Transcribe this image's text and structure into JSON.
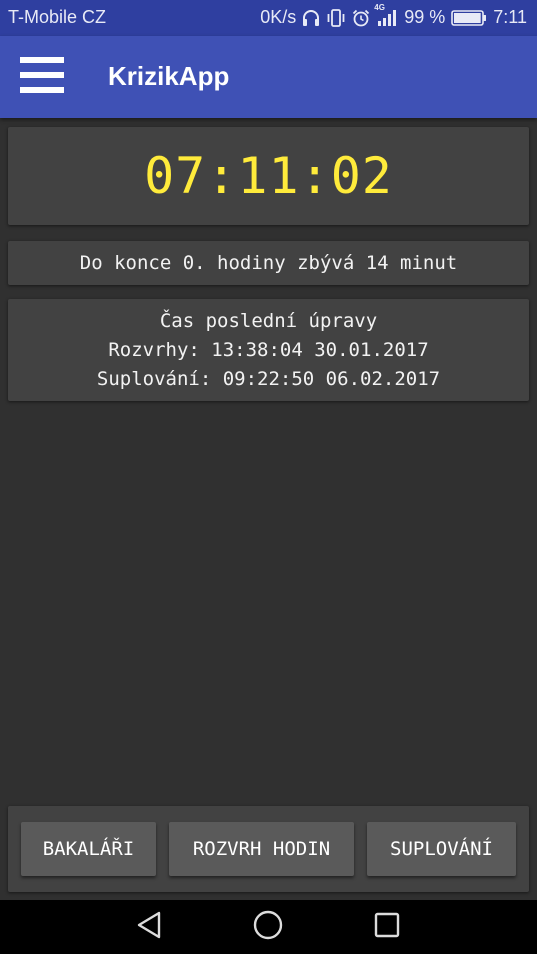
{
  "status_bar": {
    "carrier": "T-Mobile CZ",
    "speed": "0K/s",
    "network_type": "4G",
    "battery_percent": "99 %",
    "battery_level": 0.99,
    "time": "7:11",
    "icons": [
      "headphones-icon",
      "vibrate-icon",
      "alarm-icon",
      "signal-icon",
      "battery-icon"
    ]
  },
  "app_bar": {
    "title": "KrizikApp",
    "menu_icon": "hamburger-menu-icon",
    "color": "#3f51b5"
  },
  "clock": {
    "time": "07:11:02",
    "color": "#ffeb3b"
  },
  "remaining": {
    "text": "Do konce 0. hodiny zbývá 14 minut"
  },
  "last_update": {
    "heading": "Čas poslední úpravy",
    "schedules": "Rozvrhy: 13:38:04 30.01.2017",
    "substitutions": "Suplování: 09:22:50 06.02.2017"
  },
  "buttons": {
    "bakalari": "BAKALÁŘI",
    "timetable": "ROZVRH HODIN",
    "substitutions": "SUPLOVÁNÍ"
  },
  "nav_bar": {
    "icons": [
      "back-icon",
      "home-icon",
      "recents-icon"
    ]
  }
}
